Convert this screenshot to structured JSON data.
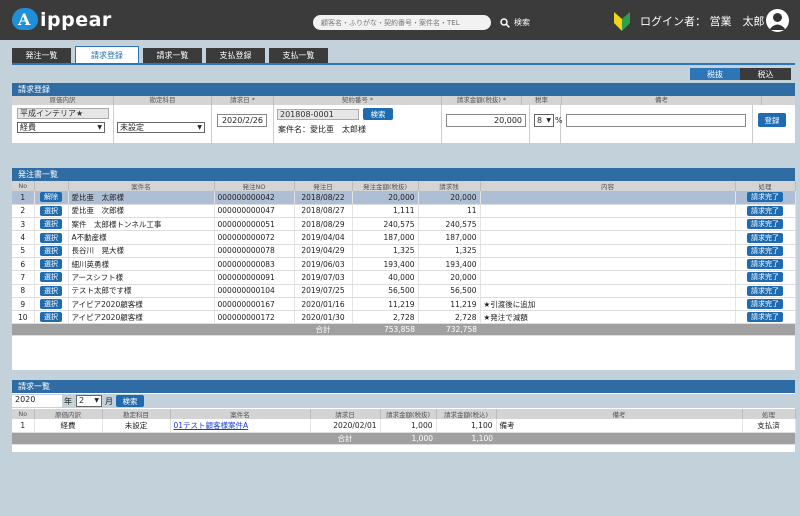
{
  "header": {
    "logo_mark": "A",
    "logo_text": "ippear",
    "search_placeholder": "顧客名・ふりがな・契約番号・案件名・TEL",
    "search_button": "検索",
    "login_label": "ログイン者： 営業　太郎"
  },
  "tabs": [
    {
      "label": "発注一覧"
    },
    {
      "label": "請求登録"
    },
    {
      "label": "請求一覧"
    },
    {
      "label": "支払登録"
    },
    {
      "label": "支払一覧"
    }
  ],
  "tax_toggle": {
    "off_label": "税抜",
    "on_label": "税込"
  },
  "registration": {
    "title": "請求登録",
    "columns": [
      "原価内訳",
      "勘定科目",
      "請求日 *",
      "契約番号 *",
      "請求金額(税抜) *",
      "税率",
      "備考"
    ],
    "vendor": "平成インテリア★",
    "cost_breakdown": "経費",
    "account_subject": "未設定",
    "invoice_date": "2020/2/26",
    "contract_no": "201808-0001",
    "search_button": "検索",
    "project_name": "案件名：愛比亜　太郎様",
    "amount": "20,000",
    "tax_rate": "8",
    "tax_unit": "%",
    "remarks": "",
    "register_button": "登録"
  },
  "orders": {
    "title": "発注書一覧",
    "columns": [
      "No",
      "",
      "案件名",
      "発注NO",
      "発注日",
      "発注金額(税抜)",
      "請求残",
      "内容",
      "処理"
    ],
    "rows": [
      {
        "no": "1",
        "action": "解除",
        "name": "愛比亜　太郎様",
        "order_no": "000000000042",
        "date": "2018/08/22",
        "amount": "20,000",
        "remaining": "20,000",
        "content": "",
        "process": "請求完了",
        "selected": true
      },
      {
        "no": "2",
        "action": "選択",
        "name": "愛比亜　次郎様",
        "order_no": "000000000047",
        "date": "2018/08/27",
        "amount": "1,111",
        "remaining": "11",
        "content": "",
        "process": "請求完了",
        "selected": false
      },
      {
        "no": "3",
        "action": "選択",
        "name": "案件　太郎様トンネル工事",
        "order_no": "000000000051",
        "date": "2018/08/29",
        "amount": "240,575",
        "remaining": "240,575",
        "content": "",
        "process": "請求完了",
        "selected": false
      },
      {
        "no": "4",
        "action": "選択",
        "name": "A不動産様",
        "order_no": "000000000072",
        "date": "2019/04/04",
        "amount": "187,000",
        "remaining": "187,000",
        "content": "",
        "process": "請求完了",
        "selected": false
      },
      {
        "no": "5",
        "action": "選択",
        "name": "長谷川　晃大様",
        "order_no": "000000000078",
        "date": "2019/04/29",
        "amount": "1,325",
        "remaining": "1,325",
        "content": "",
        "process": "請求完了",
        "selected": false
      },
      {
        "no": "6",
        "action": "選択",
        "name": "細川英勇様",
        "order_no": "000000000083",
        "date": "2019/06/03",
        "amount": "193,400",
        "remaining": "193,400",
        "content": "",
        "process": "請求完了",
        "selected": false
      },
      {
        "no": "7",
        "action": "選択",
        "name": "アースシフト様",
        "order_no": "000000000091",
        "date": "2019/07/03",
        "amount": "40,000",
        "remaining": "20,000",
        "content": "",
        "process": "請求完了",
        "selected": false
      },
      {
        "no": "8",
        "action": "選択",
        "name": "テスト太郎です様",
        "order_no": "000000000104",
        "date": "2019/07/25",
        "amount": "56,500",
        "remaining": "56,500",
        "content": "",
        "process": "請求完了",
        "selected": false
      },
      {
        "no": "9",
        "action": "選択",
        "name": "アイピア2020顧客様",
        "order_no": "000000000167",
        "date": "2020/01/16",
        "amount": "11,219",
        "remaining": "11,219",
        "content": "★引渡後に追加",
        "process": "請求完了",
        "selected": false
      },
      {
        "no": "10",
        "action": "選択",
        "name": "アイピア2020顧客様",
        "order_no": "000000000172",
        "date": "2020/01/30",
        "amount": "2,728",
        "remaining": "2,728",
        "content": "★発注で減額",
        "process": "請求完了",
        "selected": false
      }
    ],
    "total_label": "合計",
    "total_amount": "753,858",
    "total_remaining": "732,758"
  },
  "invoices": {
    "title": "請求一覧",
    "year": "2020",
    "year_unit": "年",
    "month": "2",
    "month_unit": "月",
    "search_button": "検索",
    "columns": [
      "No",
      "原価内訳",
      "勘定科目",
      "案件名",
      "請求日",
      "請求金額(税抜)",
      "請求金額(税込)",
      "備考",
      "処理"
    ],
    "rows": [
      {
        "no": "1",
        "cost": "経費",
        "subject": "未設定",
        "name": "01テスト顧客様案件A",
        "date": "2020/02/01",
        "amount": "1,000",
        "amount_tax": "1,100",
        "remarks": "備考",
        "process": "支払済"
      }
    ],
    "total_label": "合計",
    "total_amount": "1,000",
    "total_amount_tax": "1,100"
  }
}
